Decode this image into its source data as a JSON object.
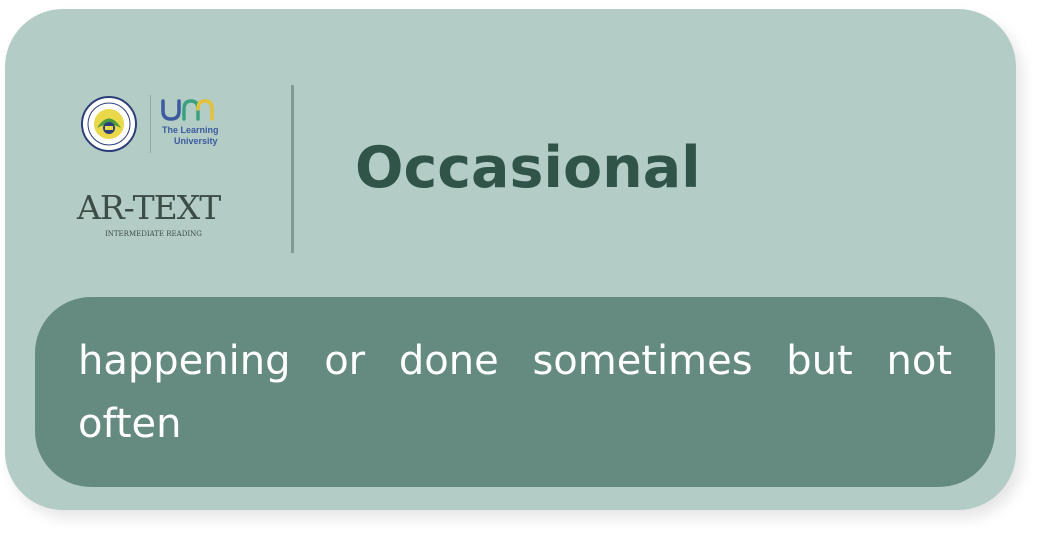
{
  "card": {
    "word": "Occasional",
    "definition": "happening or done sometimes but not often"
  },
  "branding": {
    "seal_icon": "university-seal-icon",
    "um_mark": "um",
    "um_tagline_line1": "The Learning",
    "um_tagline_line2": "University",
    "product_name": "AR-TEXT",
    "product_subtitle": "INTERMEDIATE READING"
  },
  "colors": {
    "card_background": "#b3ccc5",
    "definition_background": "#658a7f",
    "word_color": "#305548",
    "definition_text": "#ffffff",
    "um_blue": "#3b5b9e",
    "um_green": "#3aa17e",
    "um_yellow": "#e3c23a"
  }
}
